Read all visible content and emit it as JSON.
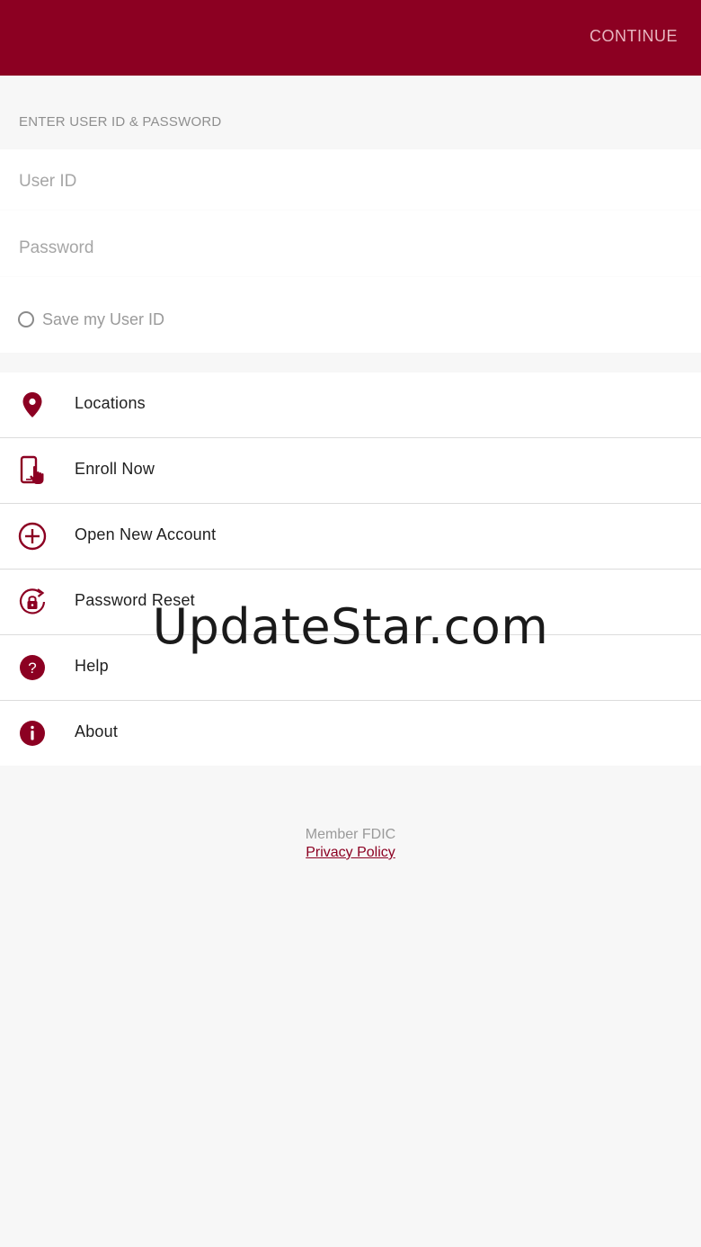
{
  "header": {
    "continue_label": "CONTINUE",
    "background_color": "#8c0022"
  },
  "login": {
    "section_title": "ENTER USER ID & PASSWORD",
    "user_id_placeholder": "User ID",
    "password_placeholder": "Password",
    "save_user_id_label": "Save my User ID",
    "save_user_id_checked": false
  },
  "menu": {
    "items": [
      {
        "label": "Locations",
        "icon": "map-pin-icon"
      },
      {
        "label": "Enroll Now",
        "icon": "phone-tap-icon"
      },
      {
        "label": "Open New Account",
        "icon": "plus-circle-icon"
      },
      {
        "label": "Password Reset",
        "icon": "lock-reset-icon"
      },
      {
        "label": "Help",
        "icon": "question-circle-icon"
      },
      {
        "label": "About",
        "icon": "info-circle-icon"
      }
    ]
  },
  "footer": {
    "fdic_text": "Member FDIC",
    "privacy_link": "Privacy Policy"
  },
  "watermark": {
    "text": "UpdateStar.com"
  },
  "colors": {
    "accent": "#8c0022",
    "background": "#f7f7f7"
  }
}
